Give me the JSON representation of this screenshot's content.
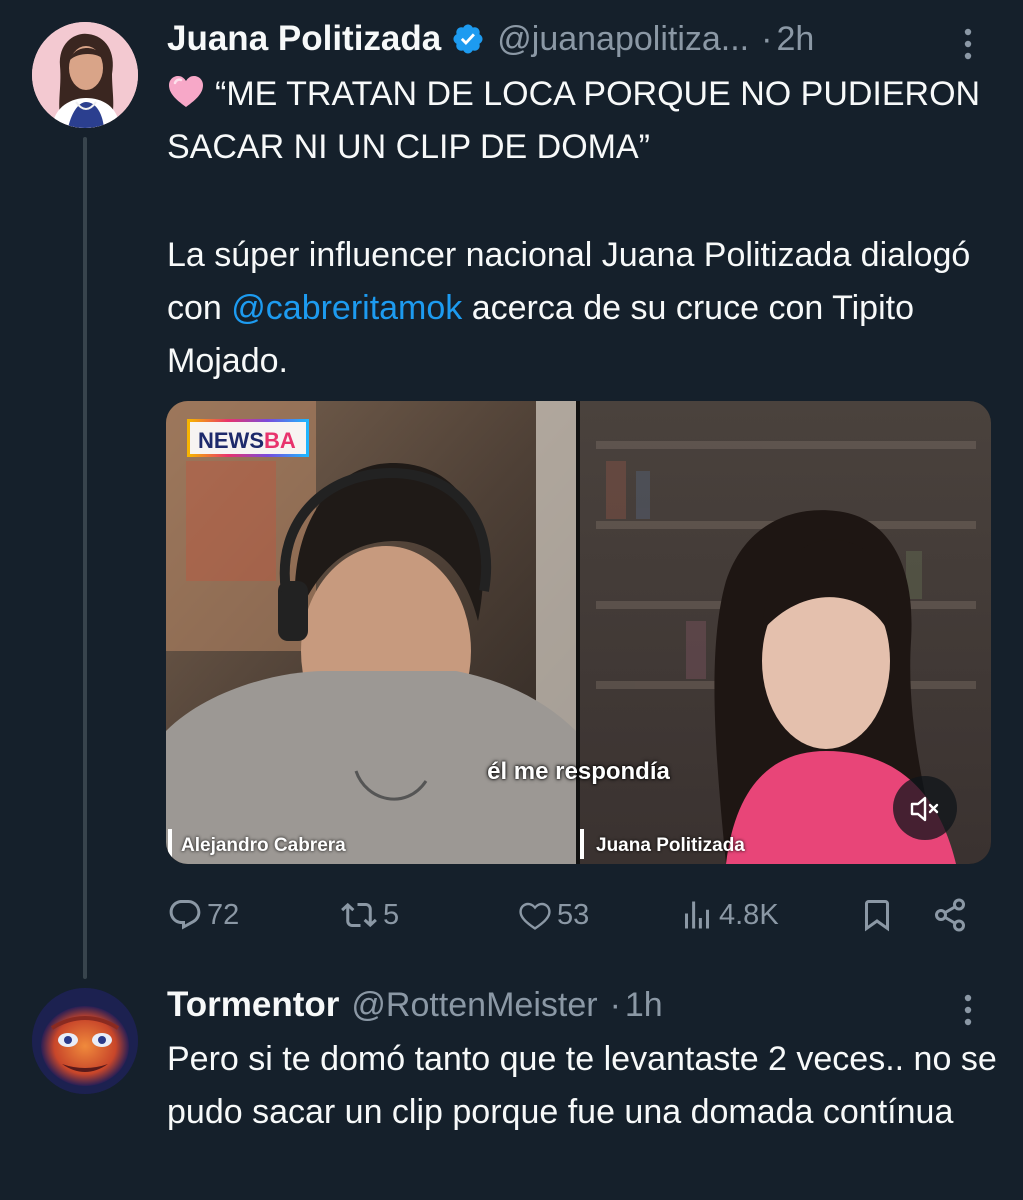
{
  "tweets": [
    {
      "display_name": "Juana Politizada",
      "verified": true,
      "handle": "@juanapolitiza...",
      "separator": "·",
      "time": "2h",
      "emoji": "pink-heart-emoji",
      "headline": "“ME TRATAN DE LOCA PORQUE NO PUDIERON SACAR NI UN CLIP DE DOMA”",
      "body_before_mention": "La súper influencer nacional Juana Politizada dialogó con ",
      "mention": "@cabreritamok",
      "body_after_mention": " acerca de su cruce con Tipito Mojado.",
      "media": {
        "logo_news": "NEWS",
        "logo_ba": "BA",
        "caption": "él me respondía",
        "left_label": "Alejandro Cabrera",
        "right_label": "Juana Politizada",
        "mute_icon": "volume-muted-icon"
      },
      "actions": {
        "replies": "72",
        "reposts": "5",
        "likes": "53",
        "views": "4.8K"
      }
    },
    {
      "display_name": "Tormentor",
      "handle": "@RottenMeister",
      "separator": "·",
      "time": "1h",
      "body": "Pero si te domó tanto que te levantaste 2 veces.. no se pudo sacar un clip porque fue una domada contínua"
    }
  ],
  "colors": {
    "background": "#15202b",
    "text_primary": "#f7f9f9",
    "text_secondary": "#8b98a5",
    "link": "#1d9bf0",
    "verified": "#1d9bf0",
    "thread_line": "#38444d"
  }
}
